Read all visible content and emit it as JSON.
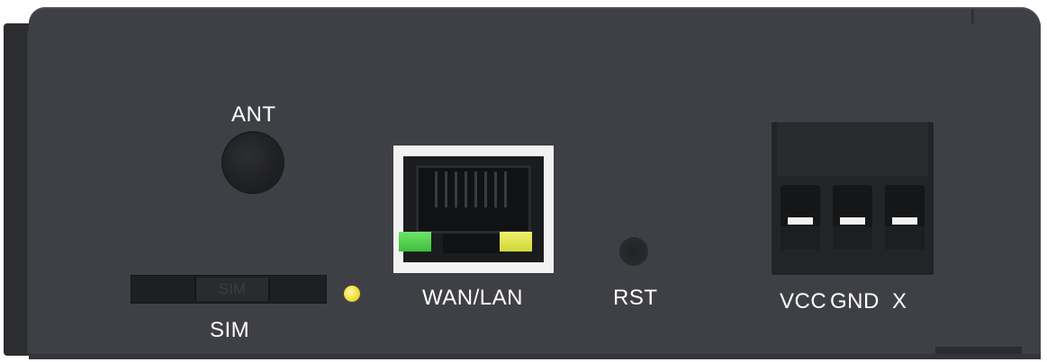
{
  "labels": {
    "antenna": "ANT",
    "sim": "SIM",
    "sim_tray_marking": "SIM",
    "ethernet": "WAN/LAN",
    "reset": "RST",
    "vcc": "VCC",
    "gnd": "GND",
    "x": "X"
  },
  "colors": {
    "housing": "#3f4045",
    "port_frame": "#f2f2f2",
    "link_led": "#3fbf3a",
    "activity_led": "#cfd63a",
    "status_led": "#f2df3a",
    "text": "#ffffff"
  },
  "icons": {
    "antenna_connector": "round-antenna-connector",
    "ethernet_port": "rj45-port",
    "reset_button": "pinhole-reset",
    "power_terminal": "screw-terminal-block"
  }
}
